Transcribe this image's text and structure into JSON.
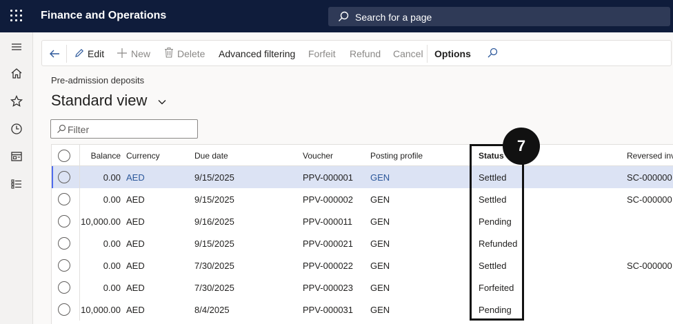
{
  "app": {
    "title": "Finance and Operations"
  },
  "search": {
    "placeholder": "Search for a page"
  },
  "leftnav": {
    "items": [
      "hamburger-icon",
      "home-icon",
      "star-icon",
      "clock-icon",
      "workspace-icon",
      "list-icon"
    ]
  },
  "toolbar": {
    "edit": "Edit",
    "new": "New",
    "delete": "Delete",
    "advanced_filtering": "Advanced filtering",
    "forfeit": "Forfeit",
    "refund": "Refund",
    "cancel": "Cancel",
    "options": "Options"
  },
  "page": {
    "breadcrumb": "Pre-admission deposits",
    "view_title": "Standard view"
  },
  "filter": {
    "placeholder": "Filter"
  },
  "grid": {
    "columns": [
      "Balance",
      "Currency",
      "Due date",
      "Voucher",
      "Posting profile",
      "Status",
      "Reversed inv"
    ],
    "rows": [
      {
        "balance": "0.00",
        "currency": "AED",
        "due_date": "9/15/2025",
        "voucher": "PPV-000001",
        "posting_profile": "GEN",
        "status": "Settled",
        "reversed": "SC-000000",
        "selected": true
      },
      {
        "balance": "0.00",
        "currency": "AED",
        "due_date": "9/15/2025",
        "voucher": "PPV-000002",
        "posting_profile": "GEN",
        "status": "Settled",
        "reversed": "SC-000000",
        "selected": false
      },
      {
        "balance": "10,000.00",
        "currency": "AED",
        "due_date": "9/16/2025",
        "voucher": "PPV-000011",
        "posting_profile": "GEN",
        "status": "Pending",
        "reversed": "",
        "selected": false
      },
      {
        "balance": "0.00",
        "currency": "AED",
        "due_date": "9/15/2025",
        "voucher": "PPV-000021",
        "posting_profile": "GEN",
        "status": "Refunded",
        "reversed": "",
        "selected": false
      },
      {
        "balance": "0.00",
        "currency": "AED",
        "due_date": "7/30/2025",
        "voucher": "PPV-000022",
        "posting_profile": "GEN",
        "status": "Settled",
        "reversed": "SC-000000",
        "selected": false
      },
      {
        "balance": "0.00",
        "currency": "AED",
        "due_date": "7/30/2025",
        "voucher": "PPV-000023",
        "posting_profile": "GEN",
        "status": "Forfeited",
        "reversed": "",
        "selected": false
      },
      {
        "balance": "10,000.00",
        "currency": "AED",
        "due_date": "8/4/2025",
        "voucher": "PPV-000031",
        "posting_profile": "GEN",
        "status": "Pending",
        "reversed": "",
        "selected": false
      }
    ]
  },
  "annotation": {
    "badge": "7"
  }
}
